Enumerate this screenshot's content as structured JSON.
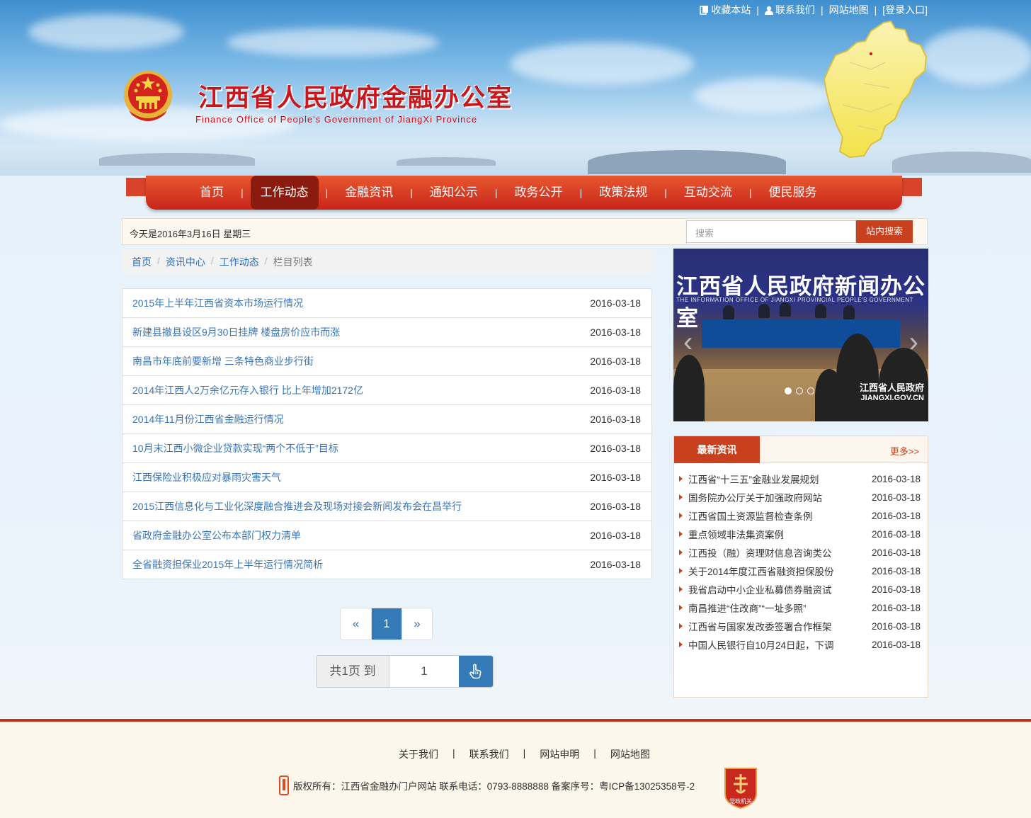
{
  "header": {
    "title_cn": "江西省人民政府金融办公室",
    "title_en": "Finance Office of People's Government of JiangXi Province",
    "top_links": [
      "收藏本站",
      "联系我们",
      "网站地图",
      "[登录入口]"
    ]
  },
  "nav": {
    "items": [
      "首页",
      "工作动态",
      "金融资讯",
      "通知公示",
      "政务公开",
      "政策法规",
      "互动交流",
      "便民服务"
    ],
    "active": "工作动态"
  },
  "infobar": {
    "date": "今天是2016年3月16日 星期三",
    "search_placeholder": "搜索",
    "search_button": "站内搜索"
  },
  "breadcrumb": {
    "items": [
      "首页",
      "资讯中心",
      "工作动态"
    ],
    "current": "栏目列表"
  },
  "articles": [
    {
      "title": "2015年上半年江西省资本市场运行情况",
      "date": "2016-03-18"
    },
    {
      "title": "新建县撤县设区9月30日挂牌 楼盘房价应市而涨",
      "date": "2016-03-18"
    },
    {
      "title": "南昌市年底前要新增 三条特色商业步行街",
      "date": "2016-03-18"
    },
    {
      "title": "2014年江西人2万余亿元存入银行 比上年增加2172亿",
      "date": "2016-03-18"
    },
    {
      "title": "2014年11月份江西省金融运行情况",
      "date": "2016-03-18"
    },
    {
      "title": "10月末江西小微企业贷款实现“两个不低于”目标",
      "date": "2016-03-18"
    },
    {
      "title": "江西保险业积极应对暴雨灾害天气",
      "date": "2016-03-18"
    },
    {
      "title": "2015江西信息化与工业化深度融合推进会及现场对接会新闻发布会在昌举行",
      "date": "2016-03-18"
    },
    {
      "title": "省政府金融办公室公布本部门权力清单",
      "date": "2016-03-18"
    },
    {
      "title": "全省融资担保业2015年上半年运行情况简析",
      "date": "2016-03-18"
    }
  ],
  "pager": {
    "prev": "«",
    "current": "1",
    "next": "»",
    "total_label": "共1页 到",
    "goto_value": "1"
  },
  "slideshow": {
    "banner": "江西省人民政府新闻办公室",
    "banner_en": "THE INFORMATION OFFICE OF JIANGXI PROVINCIAL PEOPLE'S GOVERNMENT",
    "watermark_cn": "江西省人民政府",
    "watermark_en": "JIANGXI.GOV.CN"
  },
  "latest_news": {
    "title": "最新资讯",
    "more": "更多>>",
    "items": [
      {
        "title": "江西省“十三五”金融业发展规划",
        "date": "2016-03-18"
      },
      {
        "title": "国务院办公厅关于加强政府网站",
        "date": "2016-03-18"
      },
      {
        "title": "江西省国土资源监督检查条例",
        "date": "2016-03-18"
      },
      {
        "title": "重点领域非法集资案例",
        "date": "2016-03-18"
      },
      {
        "title": "江西投（融）资理财信息咨询类公",
        "date": "2016-03-18"
      },
      {
        "title": "关于2014年度江西省融资担保股份",
        "date": "2016-03-18"
      },
      {
        "title": "我省启动中小企业私募债券融资试",
        "date": "2016-03-18"
      },
      {
        "title": "南昌推进“住改商”“一址多照”",
        "date": "2016-03-18"
      },
      {
        "title": "江西省与国家发改委签署合作框架",
        "date": "2016-03-18"
      },
      {
        "title": "中国人民银行自10月24日起，下调",
        "date": "2016-03-18"
      }
    ]
  },
  "footer": {
    "links": [
      "关于我们",
      "联系我们",
      "网站申明",
      "网站地图"
    ],
    "copyright": "版权所有：江西省金融办门户网站 联系电话：0793-8888888 备案序号：粤ICP备13025358号-2",
    "badge_text": "党政机关"
  },
  "colors": {
    "brand_red": "#c8161d",
    "nav_red": "#d9432b",
    "link_blue": "#3a76b8",
    "pager_blue": "#337ab7"
  }
}
